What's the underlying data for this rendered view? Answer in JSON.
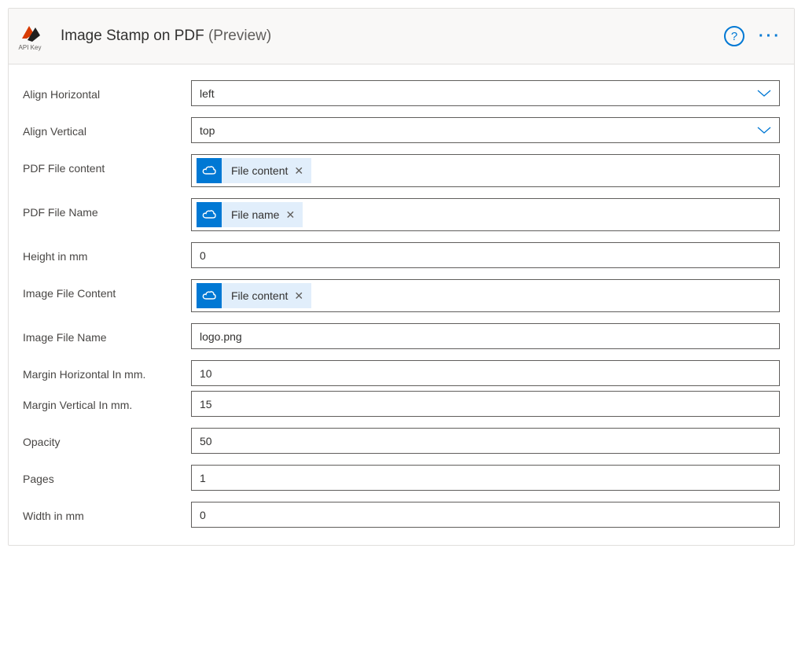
{
  "header": {
    "title": "Image Stamp on PDF",
    "suffix": "(Preview)",
    "api_label": "API Key"
  },
  "fields": {
    "align_horizontal": {
      "label": "Align Horizontal",
      "value": "left"
    },
    "align_vertical": {
      "label": "Align Vertical",
      "value": "top"
    },
    "pdf_content": {
      "label": "PDF File content",
      "token": "File content"
    },
    "pdf_name": {
      "label": "PDF File Name",
      "token": "File name"
    },
    "height_mm": {
      "label": "Height in mm",
      "value": "0"
    },
    "image_content": {
      "label": "Image File Content",
      "token": "File content"
    },
    "image_name": {
      "label": "Image File Name",
      "value": "logo.png"
    },
    "margin_h": {
      "label": "Margin Horizontal In mm.",
      "value": "10"
    },
    "margin_v": {
      "label": "Margin Vertical In mm.",
      "value": "15"
    },
    "opacity": {
      "label": "Opacity",
      "value": "50"
    },
    "pages": {
      "label": "Pages",
      "value": "1"
    },
    "width_mm": {
      "label": "Width in mm",
      "value": "0"
    }
  }
}
